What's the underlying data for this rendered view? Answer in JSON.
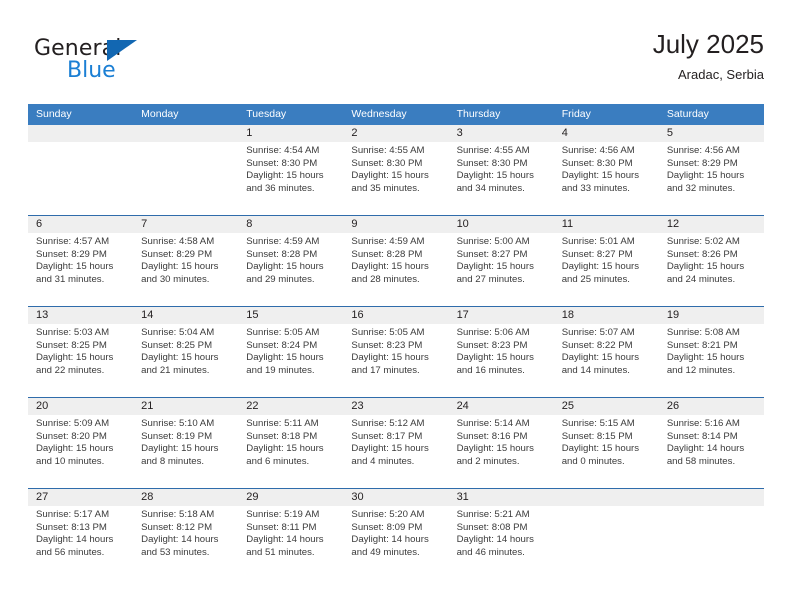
{
  "brand": {
    "name_part1": "General",
    "name_part2": "Blue",
    "accent_color": "#1267b2",
    "blue_text_color": "#1b7fd4"
  },
  "header": {
    "title": "July 2025",
    "location": "Aradac, Serbia",
    "header_bg_color": "#3a7dc0",
    "row_divider_color": "#2f6cab",
    "day_number_bg_color": "#efefef"
  },
  "weekdays": [
    "Sunday",
    "Monday",
    "Tuesday",
    "Wednesday",
    "Thursday",
    "Friday",
    "Saturday"
  ],
  "weeks": [
    [
      {
        "day": "",
        "sunrise": "",
        "sunset": "",
        "daylight_line1": "",
        "daylight_line2": "",
        "empty": true
      },
      {
        "day": "",
        "sunrise": "",
        "sunset": "",
        "daylight_line1": "",
        "daylight_line2": "",
        "empty": true
      },
      {
        "day": "1",
        "sunrise": "Sunrise: 4:54 AM",
        "sunset": "Sunset: 8:30 PM",
        "daylight_line1": "Daylight: 15 hours",
        "daylight_line2": "and 36 minutes.",
        "empty": false
      },
      {
        "day": "2",
        "sunrise": "Sunrise: 4:55 AM",
        "sunset": "Sunset: 8:30 PM",
        "daylight_line1": "Daylight: 15 hours",
        "daylight_line2": "and 35 minutes.",
        "empty": false
      },
      {
        "day": "3",
        "sunrise": "Sunrise: 4:55 AM",
        "sunset": "Sunset: 8:30 PM",
        "daylight_line1": "Daylight: 15 hours",
        "daylight_line2": "and 34 minutes.",
        "empty": false
      },
      {
        "day": "4",
        "sunrise": "Sunrise: 4:56 AM",
        "sunset": "Sunset: 8:30 PM",
        "daylight_line1": "Daylight: 15 hours",
        "daylight_line2": "and 33 minutes.",
        "empty": false
      },
      {
        "day": "5",
        "sunrise": "Sunrise: 4:56 AM",
        "sunset": "Sunset: 8:29 PM",
        "daylight_line1": "Daylight: 15 hours",
        "daylight_line2": "and 32 minutes.",
        "empty": false
      }
    ],
    [
      {
        "day": "6",
        "sunrise": "Sunrise: 4:57 AM",
        "sunset": "Sunset: 8:29 PM",
        "daylight_line1": "Daylight: 15 hours",
        "daylight_line2": "and 31 minutes.",
        "empty": false
      },
      {
        "day": "7",
        "sunrise": "Sunrise: 4:58 AM",
        "sunset": "Sunset: 8:29 PM",
        "daylight_line1": "Daylight: 15 hours",
        "daylight_line2": "and 30 minutes.",
        "empty": false
      },
      {
        "day": "8",
        "sunrise": "Sunrise: 4:59 AM",
        "sunset": "Sunset: 8:28 PM",
        "daylight_line1": "Daylight: 15 hours",
        "daylight_line2": "and 29 minutes.",
        "empty": false
      },
      {
        "day": "9",
        "sunrise": "Sunrise: 4:59 AM",
        "sunset": "Sunset: 8:28 PM",
        "daylight_line1": "Daylight: 15 hours",
        "daylight_line2": "and 28 minutes.",
        "empty": false
      },
      {
        "day": "10",
        "sunrise": "Sunrise: 5:00 AM",
        "sunset": "Sunset: 8:27 PM",
        "daylight_line1": "Daylight: 15 hours",
        "daylight_line2": "and 27 minutes.",
        "empty": false
      },
      {
        "day": "11",
        "sunrise": "Sunrise: 5:01 AM",
        "sunset": "Sunset: 8:27 PM",
        "daylight_line1": "Daylight: 15 hours",
        "daylight_line2": "and 25 minutes.",
        "empty": false
      },
      {
        "day": "12",
        "sunrise": "Sunrise: 5:02 AM",
        "sunset": "Sunset: 8:26 PM",
        "daylight_line1": "Daylight: 15 hours",
        "daylight_line2": "and 24 minutes.",
        "empty": false
      }
    ],
    [
      {
        "day": "13",
        "sunrise": "Sunrise: 5:03 AM",
        "sunset": "Sunset: 8:25 PM",
        "daylight_line1": "Daylight: 15 hours",
        "daylight_line2": "and 22 minutes.",
        "empty": false
      },
      {
        "day": "14",
        "sunrise": "Sunrise: 5:04 AM",
        "sunset": "Sunset: 8:25 PM",
        "daylight_line1": "Daylight: 15 hours",
        "daylight_line2": "and 21 minutes.",
        "empty": false
      },
      {
        "day": "15",
        "sunrise": "Sunrise: 5:05 AM",
        "sunset": "Sunset: 8:24 PM",
        "daylight_line1": "Daylight: 15 hours",
        "daylight_line2": "and 19 minutes.",
        "empty": false
      },
      {
        "day": "16",
        "sunrise": "Sunrise: 5:05 AM",
        "sunset": "Sunset: 8:23 PM",
        "daylight_line1": "Daylight: 15 hours",
        "daylight_line2": "and 17 minutes.",
        "empty": false
      },
      {
        "day": "17",
        "sunrise": "Sunrise: 5:06 AM",
        "sunset": "Sunset: 8:23 PM",
        "daylight_line1": "Daylight: 15 hours",
        "daylight_line2": "and 16 minutes.",
        "empty": false
      },
      {
        "day": "18",
        "sunrise": "Sunrise: 5:07 AM",
        "sunset": "Sunset: 8:22 PM",
        "daylight_line1": "Daylight: 15 hours",
        "daylight_line2": "and 14 minutes.",
        "empty": false
      },
      {
        "day": "19",
        "sunrise": "Sunrise: 5:08 AM",
        "sunset": "Sunset: 8:21 PM",
        "daylight_line1": "Daylight: 15 hours",
        "daylight_line2": "and 12 minutes.",
        "empty": false
      }
    ],
    [
      {
        "day": "20",
        "sunrise": "Sunrise: 5:09 AM",
        "sunset": "Sunset: 8:20 PM",
        "daylight_line1": "Daylight: 15 hours",
        "daylight_line2": "and 10 minutes.",
        "empty": false
      },
      {
        "day": "21",
        "sunrise": "Sunrise: 5:10 AM",
        "sunset": "Sunset: 8:19 PM",
        "daylight_line1": "Daylight: 15 hours",
        "daylight_line2": "and 8 minutes.",
        "empty": false
      },
      {
        "day": "22",
        "sunrise": "Sunrise: 5:11 AM",
        "sunset": "Sunset: 8:18 PM",
        "daylight_line1": "Daylight: 15 hours",
        "daylight_line2": "and 6 minutes.",
        "empty": false
      },
      {
        "day": "23",
        "sunrise": "Sunrise: 5:12 AM",
        "sunset": "Sunset: 8:17 PM",
        "daylight_line1": "Daylight: 15 hours",
        "daylight_line2": "and 4 minutes.",
        "empty": false
      },
      {
        "day": "24",
        "sunrise": "Sunrise: 5:14 AM",
        "sunset": "Sunset: 8:16 PM",
        "daylight_line1": "Daylight: 15 hours",
        "daylight_line2": "and 2 minutes.",
        "empty": false
      },
      {
        "day": "25",
        "sunrise": "Sunrise: 5:15 AM",
        "sunset": "Sunset: 8:15 PM",
        "daylight_line1": "Daylight: 15 hours",
        "daylight_line2": "and 0 minutes.",
        "empty": false
      },
      {
        "day": "26",
        "sunrise": "Sunrise: 5:16 AM",
        "sunset": "Sunset: 8:14 PM",
        "daylight_line1": "Daylight: 14 hours",
        "daylight_line2": "and 58 minutes.",
        "empty": false
      }
    ],
    [
      {
        "day": "27",
        "sunrise": "Sunrise: 5:17 AM",
        "sunset": "Sunset: 8:13 PM",
        "daylight_line1": "Daylight: 14 hours",
        "daylight_line2": "and 56 minutes.",
        "empty": false
      },
      {
        "day": "28",
        "sunrise": "Sunrise: 5:18 AM",
        "sunset": "Sunset: 8:12 PM",
        "daylight_line1": "Daylight: 14 hours",
        "daylight_line2": "and 53 minutes.",
        "empty": false
      },
      {
        "day": "29",
        "sunrise": "Sunrise: 5:19 AM",
        "sunset": "Sunset: 8:11 PM",
        "daylight_line1": "Daylight: 14 hours",
        "daylight_line2": "and 51 minutes.",
        "empty": false
      },
      {
        "day": "30",
        "sunrise": "Sunrise: 5:20 AM",
        "sunset": "Sunset: 8:09 PM",
        "daylight_line1": "Daylight: 14 hours",
        "daylight_line2": "and 49 minutes.",
        "empty": false
      },
      {
        "day": "31",
        "sunrise": "Sunrise: 5:21 AM",
        "sunset": "Sunset: 8:08 PM",
        "daylight_line1": "Daylight: 14 hours",
        "daylight_line2": "and 46 minutes.",
        "empty": false
      },
      {
        "day": "",
        "sunrise": "",
        "sunset": "",
        "daylight_line1": "",
        "daylight_line2": "",
        "empty": true
      },
      {
        "day": "",
        "sunrise": "",
        "sunset": "",
        "daylight_line1": "",
        "daylight_line2": "",
        "empty": true
      }
    ]
  ]
}
